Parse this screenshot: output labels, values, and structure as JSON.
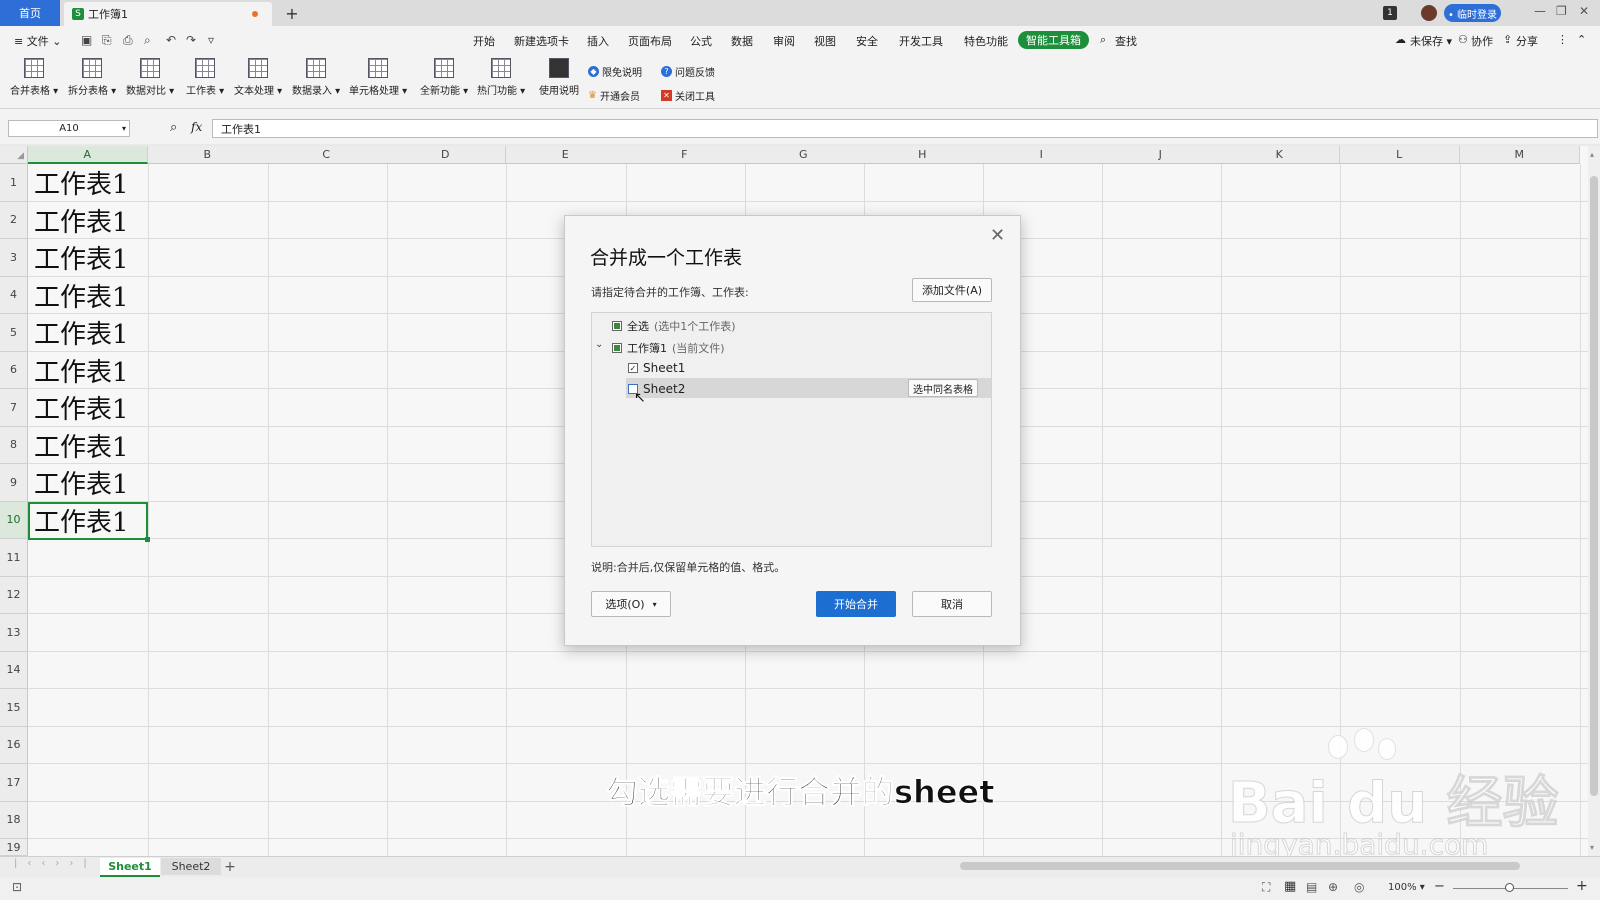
{
  "titlebar": {
    "home_tab": "首页",
    "doc_tab": "工作簿1",
    "doc_logo": "S",
    "new_tab": "+",
    "badge": "1",
    "login": "• 临时登录",
    "min": "—",
    "restore": "❐",
    "close": "✕"
  },
  "menubar": {
    "file": "≡ 文件 ⌄",
    "items": [
      "开始",
      "新建选项卡",
      "插入",
      "页面布局",
      "公式",
      "数据",
      "审阅",
      "视图",
      "安全",
      "开发工具",
      "特色功能"
    ],
    "active": "智能工具箱",
    "search": "查找",
    "unsaved": "未保存 ▾",
    "collab": "协作",
    "share": "分享"
  },
  "ribbon": {
    "buttons": [
      "合并表格 ▾",
      "拆分表格 ▾",
      "数据对比 ▾",
      "工作表 ▾",
      "文本处理 ▾",
      "数据录入 ▾",
      "单元格处理 ▾",
      "全新功能 ▾",
      "热门功能 ▾",
      "使用说明"
    ],
    "small": [
      "限免说明",
      "开通会员",
      "问题反馈",
      "关闭工具"
    ]
  },
  "formula_bar": {
    "name_box": "A10",
    "fx": "fx",
    "value": "工作表1"
  },
  "grid": {
    "columns": [
      "A",
      "B",
      "C",
      "D",
      "E",
      "F",
      "G",
      "H",
      "I",
      "J",
      "K",
      "L",
      "M"
    ],
    "rows": [
      "1",
      "2",
      "3",
      "4",
      "5",
      "6",
      "7",
      "8",
      "9",
      "10",
      "11",
      "12",
      "13",
      "14",
      "15",
      "16",
      "17",
      "18",
      "19"
    ],
    "col_a_values": [
      "工作表1",
      "工作表1",
      "工作表1",
      "工作表1",
      "工作表1",
      "工作表1",
      "工作表1",
      "工作表1",
      "工作表1",
      "工作表1"
    ],
    "selected_cell": "A10"
  },
  "sheets": {
    "tabs": [
      "Sheet1",
      "Sheet2"
    ],
    "add": "+"
  },
  "status": {
    "zoom": "100% ▾",
    "zoom_minus": "−",
    "zoom_plus": "+"
  },
  "dialog": {
    "title": "合并成一个工作表",
    "close": "✕",
    "prompt": "请指定待合并的工作簿、工作表:",
    "add_file": "添加文件(A)",
    "select_all": "全选",
    "select_all_note": "(选中1个工作表)",
    "workbook": "工作簿1",
    "workbook_note": "(当前文件)",
    "sheet1": "Sheet1",
    "sheet2": "Sheet2",
    "same_name": "选中同名表格",
    "note": "说明:合并后,仅保留单元格的值、格式。",
    "options": "选项(O)",
    "start": "开始合并",
    "cancel": "取消"
  },
  "caption": "勾选需要进行合并的sheet",
  "watermark": {
    "brand": "Bai du 经验",
    "url": "jingyan.baidu.com"
  }
}
